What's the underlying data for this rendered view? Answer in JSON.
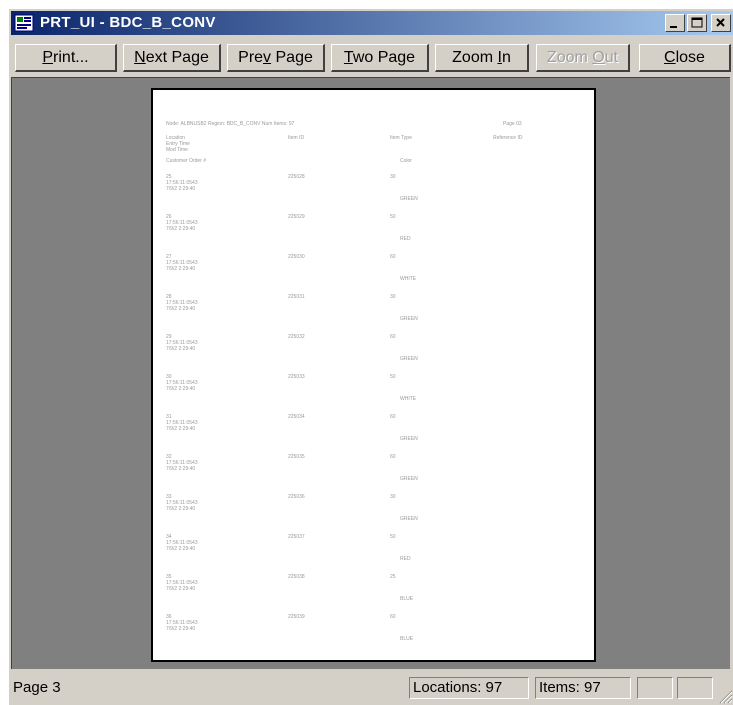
{
  "window": {
    "title": "PRT_UI - BDC_B_CONV"
  },
  "toolbar": {
    "print": {
      "pre": "",
      "u": "P",
      "post": "rint..."
    },
    "next_page": {
      "pre": "",
      "u": "N",
      "post": "ext Page"
    },
    "prev_page": {
      "pre": "Pre",
      "u": "v",
      "post": " Page"
    },
    "two_page": {
      "pre": "",
      "u": "T",
      "post": "wo Page"
    },
    "zoom_in": {
      "pre": "Zoom ",
      "u": "I",
      "post": "n"
    },
    "zoom_out": {
      "pre": "Zoom ",
      "u": "O",
      "post": "ut"
    },
    "close": {
      "pre": "",
      "u": "C",
      "post": "lose"
    }
  },
  "report": {
    "header_left": "Node: ALBNUSB2 Region: BDC_B_CONV Num Items: 97",
    "header_right": "Page 03",
    "columns": {
      "col1": "Location",
      "col1b": "Entry Time",
      "col1c": "Mod Time",
      "col1d": "Customer Order #",
      "col2": "Item ID",
      "col3": "Item Type",
      "col3b": "Color",
      "col4": "Reference ID"
    },
    "rows": [
      {
        "location": "25",
        "entry_time": "17:56:11:0543",
        "mod_time": "7/9/2 2:29:40",
        "item_id": "225028",
        "item_type": "30",
        "color": "GREEN"
      },
      {
        "location": "26",
        "entry_time": "17:56:11:0543",
        "mod_time": "7/9/2 2:29:40",
        "item_id": "225029",
        "item_type": "50",
        "color": "RED"
      },
      {
        "location": "27",
        "entry_time": "17:56:11:0543",
        "mod_time": "7/9/2 2:29:40",
        "item_id": "225030",
        "item_type": "60",
        "color": "WHITE"
      },
      {
        "location": "28",
        "entry_time": "17:56:11:0543",
        "mod_time": "7/9/2 2:29:40",
        "item_id": "225031",
        "item_type": "30",
        "color": "GREEN"
      },
      {
        "location": "29",
        "entry_time": "17:56:11:0543",
        "mod_time": "7/9/2 2:29:40",
        "item_id": "225032",
        "item_type": "60",
        "color": "GREEN"
      },
      {
        "location": "30",
        "entry_time": "17:56:11:0543",
        "mod_time": "7/9/2 2:29:40",
        "item_id": "225033",
        "item_type": "50",
        "color": "WHITE"
      },
      {
        "location": "31",
        "entry_time": "17:56:11:0543",
        "mod_time": "7/9/2 2:29:40",
        "item_id": "225034",
        "item_type": "60",
        "color": "GREEN"
      },
      {
        "location": "32",
        "entry_time": "17:56:11:0543",
        "mod_time": "7/9/2 2:29:40",
        "item_id": "225035",
        "item_type": "60",
        "color": "GREEN"
      },
      {
        "location": "33",
        "entry_time": "17:56:11:0543",
        "mod_time": "7/9/2 2:29:40",
        "item_id": "225036",
        "item_type": "30",
        "color": "GREEN"
      },
      {
        "location": "34",
        "entry_time": "17:56:11:0543",
        "mod_time": "7/9/2 2:29:40",
        "item_id": "225037",
        "item_type": "50",
        "color": "RED"
      },
      {
        "location": "35",
        "entry_time": "17:56:11:0543",
        "mod_time": "7/9/2 2:29:40",
        "item_id": "225038",
        "item_type": "25",
        "color": "BLUE"
      },
      {
        "location": "36",
        "entry_time": "17:56:11:0543",
        "mod_time": "7/9/2 2:29:40",
        "item_id": "225039",
        "item_type": "60",
        "color": "BLUE"
      }
    ]
  },
  "status": {
    "page": "Page 3",
    "locations": "Locations: 97",
    "items": "Items: 97"
  },
  "colors": {
    "title_start": "#0a246a",
    "title_end": "#a6caf0",
    "face": "#d4d0c8",
    "viewer_bg": "#808080"
  }
}
